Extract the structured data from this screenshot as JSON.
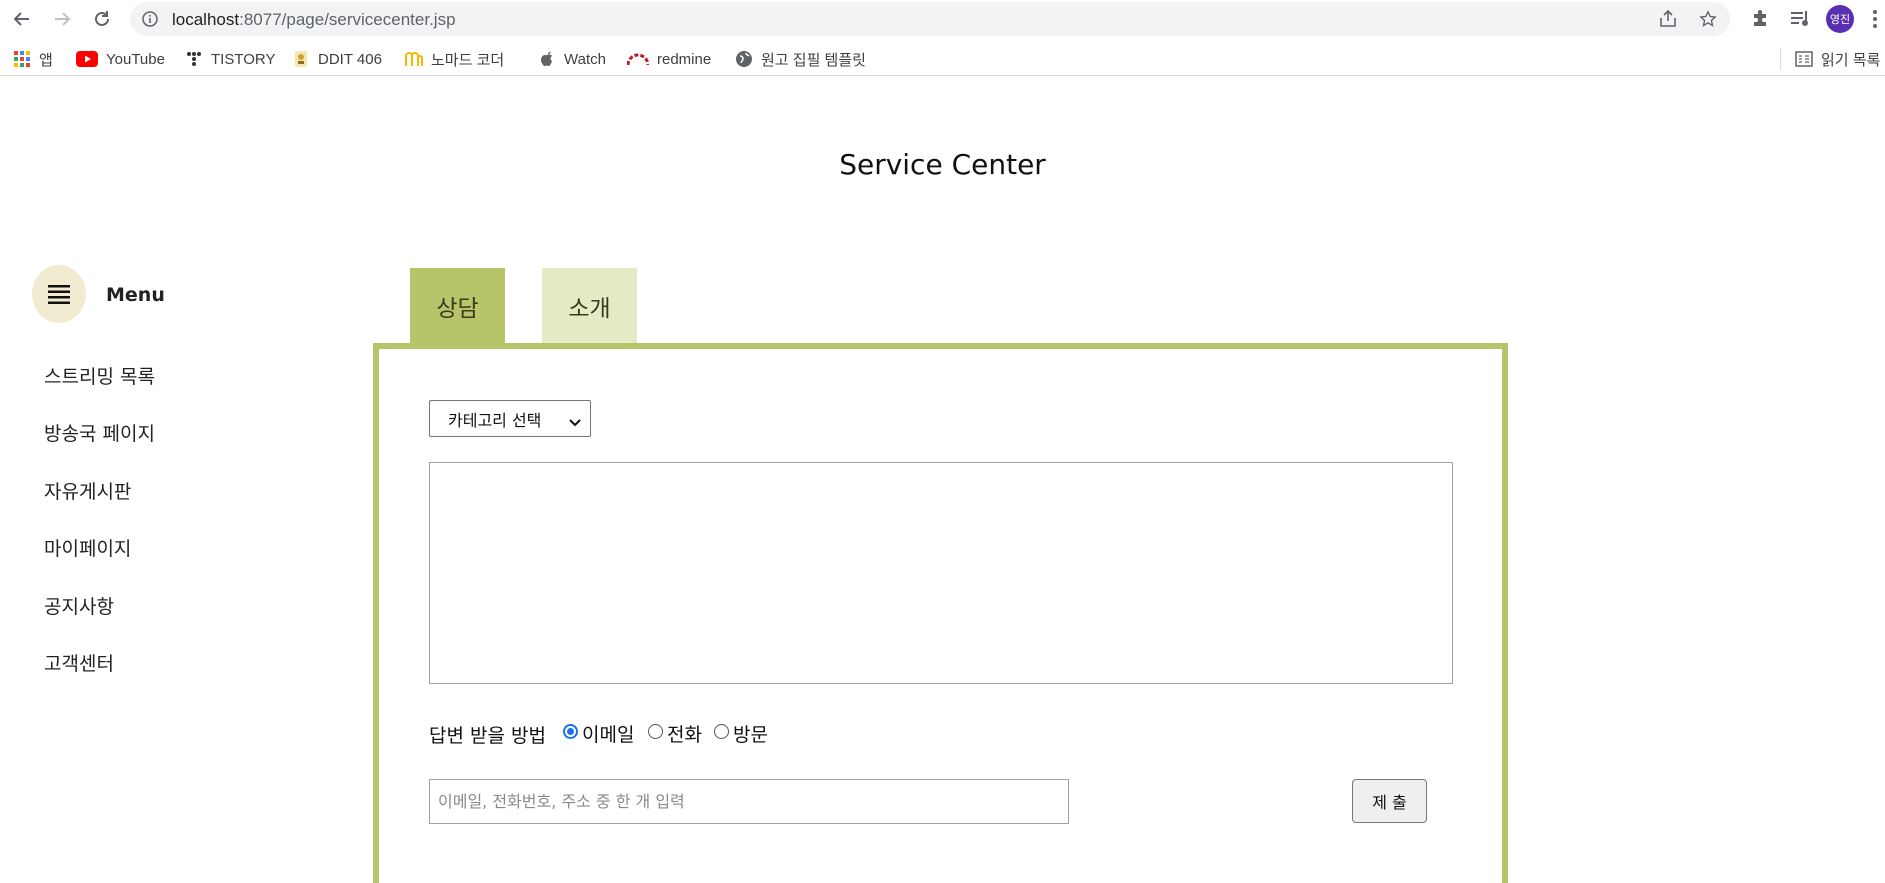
{
  "browser": {
    "url_host": "localhost",
    "url_path": ":8077/page/servicecenter.jsp",
    "profile_initials": "영진",
    "bookmarks": [
      {
        "label": "앱",
        "icon": "apps-grid-icon"
      },
      {
        "label": "YouTube",
        "icon": "youtube-icon"
      },
      {
        "label": "TISTORY",
        "icon": "tistory-icon"
      },
      {
        "label": "DDIT 406",
        "icon": "ddit-icon"
      },
      {
        "label": "노마드 코더",
        "icon": "nomad-coder-icon"
      },
      {
        "label": "Watch",
        "icon": "apple-icon"
      },
      {
        "label": "redmine",
        "icon": "redmine-icon"
      },
      {
        "label": "원고 집필 템플릿",
        "icon": "globe-icon"
      }
    ],
    "reading_list": "읽기 목록"
  },
  "page": {
    "title": "Service Center"
  },
  "sidebar": {
    "menu_label": "Menu",
    "items": [
      {
        "label": "스트리밍 목록"
      },
      {
        "label": "방송국 페이지"
      },
      {
        "label": "자유게시판"
      },
      {
        "label": "마이페이지"
      },
      {
        "label": "공지사항"
      },
      {
        "label": "고객센터"
      }
    ]
  },
  "tabs": [
    {
      "label": "상담",
      "active": true
    },
    {
      "label": "소개",
      "active": false
    }
  ],
  "form": {
    "category_select": "카테고리 선택",
    "textarea_value": "",
    "reply_method_label": "답변 받을 방법",
    "reply_options": [
      {
        "label": "이메일",
        "checked": true
      },
      {
        "label": "전화",
        "checked": false
      },
      {
        "label": "방문",
        "checked": false
      }
    ],
    "contact_placeholder": "이메일, 전화번호, 주소 중 한 개 입력",
    "contact_value": "",
    "submit_label": "제 출"
  },
  "colors": {
    "tab_active": "#b8c46a",
    "tab_inactive": "#e4e9c6",
    "panel_border": "#b8c46a",
    "menu_circle": "#f0ebd1"
  }
}
